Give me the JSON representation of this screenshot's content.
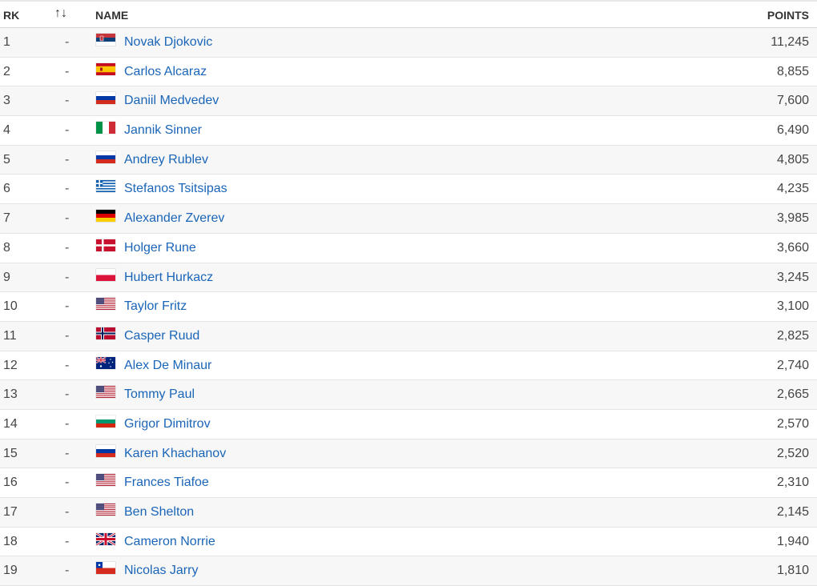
{
  "header": {
    "rk": "RK",
    "move": "↑↓",
    "name": "NAME",
    "points": "POINTS"
  },
  "rows": [
    {
      "rank": "1",
      "move": "-",
      "flag": "serbia-flag-icon",
      "name": "Novak Djokovic",
      "points": "11,245"
    },
    {
      "rank": "2",
      "move": "-",
      "flag": "spain-flag-icon",
      "name": "Carlos Alcaraz",
      "points": "8,855"
    },
    {
      "rank": "3",
      "move": "-",
      "flag": "russia-flag-icon",
      "name": "Daniil Medvedev",
      "points": "7,600"
    },
    {
      "rank": "4",
      "move": "-",
      "flag": "italy-flag-icon",
      "name": "Jannik Sinner",
      "points": "6,490"
    },
    {
      "rank": "5",
      "move": "-",
      "flag": "russia-flag-icon",
      "name": "Andrey Rublev",
      "points": "4,805"
    },
    {
      "rank": "6",
      "move": "-",
      "flag": "greece-flag-icon",
      "name": "Stefanos Tsitsipas",
      "points": "4,235"
    },
    {
      "rank": "7",
      "move": "-",
      "flag": "germany-flag-icon",
      "name": "Alexander Zverev",
      "points": "3,985"
    },
    {
      "rank": "8",
      "move": "-",
      "flag": "denmark-flag-icon",
      "name": "Holger Rune",
      "points": "3,660"
    },
    {
      "rank": "9",
      "move": "-",
      "flag": "poland-flag-icon",
      "name": "Hubert Hurkacz",
      "points": "3,245"
    },
    {
      "rank": "10",
      "move": "-",
      "flag": "usa-flag-icon",
      "name": "Taylor Fritz",
      "points": "3,100"
    },
    {
      "rank": "11",
      "move": "-",
      "flag": "norway-flag-icon",
      "name": "Casper Ruud",
      "points": "2,825"
    },
    {
      "rank": "12",
      "move": "-",
      "flag": "australia-flag-icon",
      "name": "Alex De Minaur",
      "points": "2,740"
    },
    {
      "rank": "13",
      "move": "-",
      "flag": "usa-flag-icon",
      "name": "Tommy Paul",
      "points": "2,665"
    },
    {
      "rank": "14",
      "move": "-",
      "flag": "bulgaria-flag-icon",
      "name": "Grigor Dimitrov",
      "points": "2,570"
    },
    {
      "rank": "15",
      "move": "-",
      "flag": "russia-flag-icon",
      "name": "Karen Khachanov",
      "points": "2,520"
    },
    {
      "rank": "16",
      "move": "-",
      "flag": "usa-flag-icon",
      "name": "Frances Tiafoe",
      "points": "2,310"
    },
    {
      "rank": "17",
      "move": "-",
      "flag": "usa-flag-icon",
      "name": "Ben Shelton",
      "points": "2,145"
    },
    {
      "rank": "18",
      "move": "-",
      "flag": "uk-flag-icon",
      "name": "Cameron Norrie",
      "points": "1,940"
    },
    {
      "rank": "19",
      "move": "-",
      "flag": "chile-flag-icon",
      "name": "Nicolas Jarry",
      "points": "1,810"
    }
  ]
}
